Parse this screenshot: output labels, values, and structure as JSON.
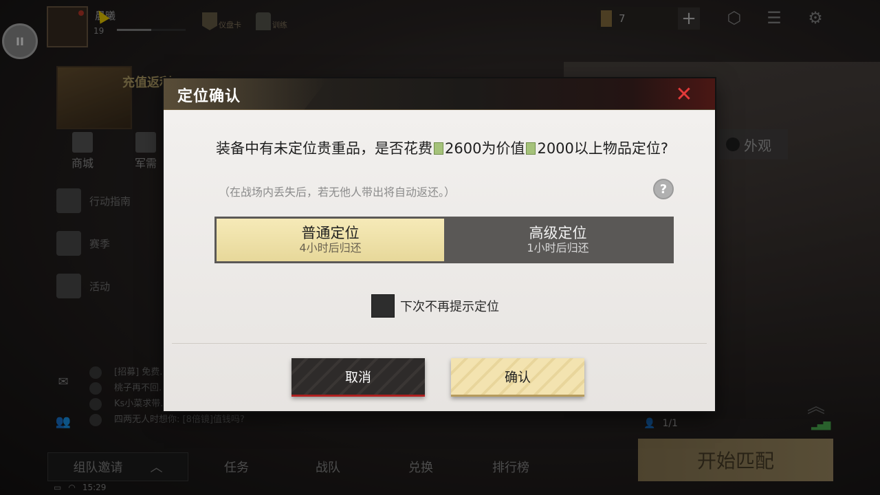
{
  "top_bar": {
    "player_name": "晨曦",
    "player_level": "19",
    "xp_progress": 0.5,
    "items": [
      "仪盘卡",
      "训练"
    ],
    "currency_amount": "7",
    "plus_label": "+",
    "pause_label": "II"
  },
  "left_sidebar": {
    "promo_label": "充值返利",
    "shop_label": "商城",
    "supply_label": "军需",
    "nav_items": [
      "行动指南",
      "赛季",
      "活动"
    ]
  },
  "chat": {
    "lines": [
      "[招募] 免费...",
      "桃子再不回...",
      "Ks小菜求带...",
      "四两无人时想你: [8倍镜]值钱吗?"
    ]
  },
  "bottom_bar": {
    "team_invite_label": "组队邀请",
    "nav": [
      "任务",
      "战队",
      "兑换",
      "排行榜"
    ],
    "start_match_label": "开始匹配",
    "squad_count": "1/1",
    "time": "15:29"
  },
  "appearance_label": "外观",
  "modal": {
    "title": "定位确认",
    "close_label": "✕",
    "message_part1": "装备中有未定位贵重品，是否花费",
    "cost": "2600",
    "message_part2": "为价值",
    "threshold": "2000",
    "message_part3": "以上物品定位?",
    "hint": "（在战场内丢失后，若无他人带出将自动返还。）",
    "help_label": "?",
    "options": [
      {
        "title": "普通定位",
        "subtitle": "4小时后归还",
        "selected": true
      },
      {
        "title": "高级定位",
        "subtitle": "1小时后归还",
        "selected": false
      }
    ],
    "dont_remind_label": "下次不再提示定位",
    "cancel_label": "取消",
    "confirm_label": "确认"
  },
  "colors": {
    "accent_gold": "#e7d89a",
    "close_red": "#e23a3a",
    "modal_bg": "#eeebe8",
    "option_inactive_bg": "#5a5856"
  },
  "icons": {
    "pause": "pause-icon",
    "close": "close-icon",
    "help": "help-icon",
    "cash": "cash-icon",
    "settings": "gear-icon",
    "menu": "list-icon",
    "badge": "badge-icon"
  }
}
